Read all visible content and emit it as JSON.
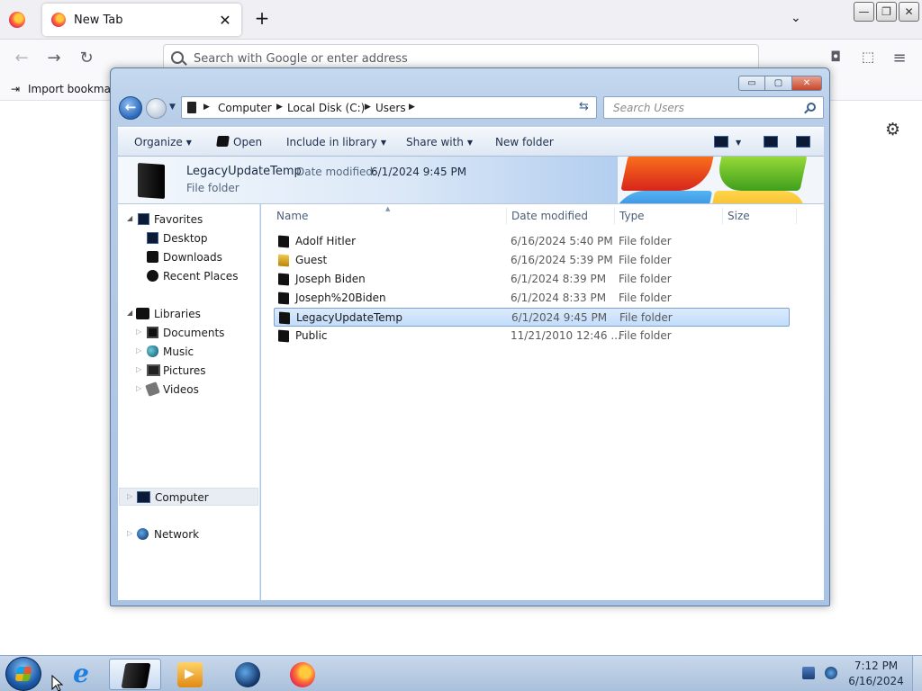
{
  "firefox": {
    "tab_title": "New Tab",
    "tab_close": "✕",
    "new_tab": "+",
    "list_tabs": "⌄",
    "window_buttons": [
      "—",
      "❐",
      "✕"
    ],
    "nav_icons": [
      "←",
      "→",
      "↻"
    ],
    "url_placeholder": "Search with Google or enter address",
    "toolbar_icons": [
      "◘",
      "⬚",
      "≡"
    ],
    "bookmark_label": "Import bookmark",
    "settings_icon": "⚙"
  },
  "explorer": {
    "window_controls": [
      "▭",
      "▢",
      "✕"
    ],
    "back_arrow": "←",
    "breadcrumbs": [
      "Computer",
      "Local Disk (C:)",
      "Users"
    ],
    "search_placeholder": "Search Users",
    "toolbar": {
      "organize": "Organize",
      "open": "Open",
      "include_in_library": "Include in library",
      "share_with": "Share with",
      "new_folder": "New folder"
    },
    "details": {
      "name": "LegacyUpdateTemp",
      "date_label": "Date modified:",
      "date_value": "6/1/2024 9:45 PM",
      "type": "File folder"
    },
    "nav": {
      "favorites": "Favorites",
      "desktop": "Desktop",
      "downloads": "Downloads",
      "recent_places": "Recent Places",
      "libraries": "Libraries",
      "documents": "Documents",
      "music": "Music",
      "pictures": "Pictures",
      "videos": "Videos",
      "computer": "Computer",
      "network": "Network"
    },
    "columns": {
      "name": "Name",
      "date_modified": "Date modified",
      "type": "Type",
      "size": "Size"
    },
    "files": [
      {
        "name": "Adolf Hitler",
        "date": "6/16/2024 5:40 PM",
        "type": "File folder"
      },
      {
        "name": "Guest",
        "date": "6/16/2024 5:39 PM",
        "type": "File folder"
      },
      {
        "name": "Joseph Biden",
        "date": "6/1/2024 8:39 PM",
        "type": "File folder"
      },
      {
        "name": "Joseph%20Biden",
        "date": "6/1/2024 8:33 PM",
        "type": "File folder"
      },
      {
        "name": "LegacyUpdateTemp",
        "date": "6/1/2024 9:45 PM",
        "type": "File folder"
      },
      {
        "name": "Public",
        "date": "11/21/2010 12:46 ...",
        "type": "File folder"
      }
    ],
    "selected_file": "LegacyUpdateTemp"
  },
  "taskbar": {
    "ie_glyph": "e",
    "time": "7:12 PM",
    "date": "6/16/2024"
  }
}
